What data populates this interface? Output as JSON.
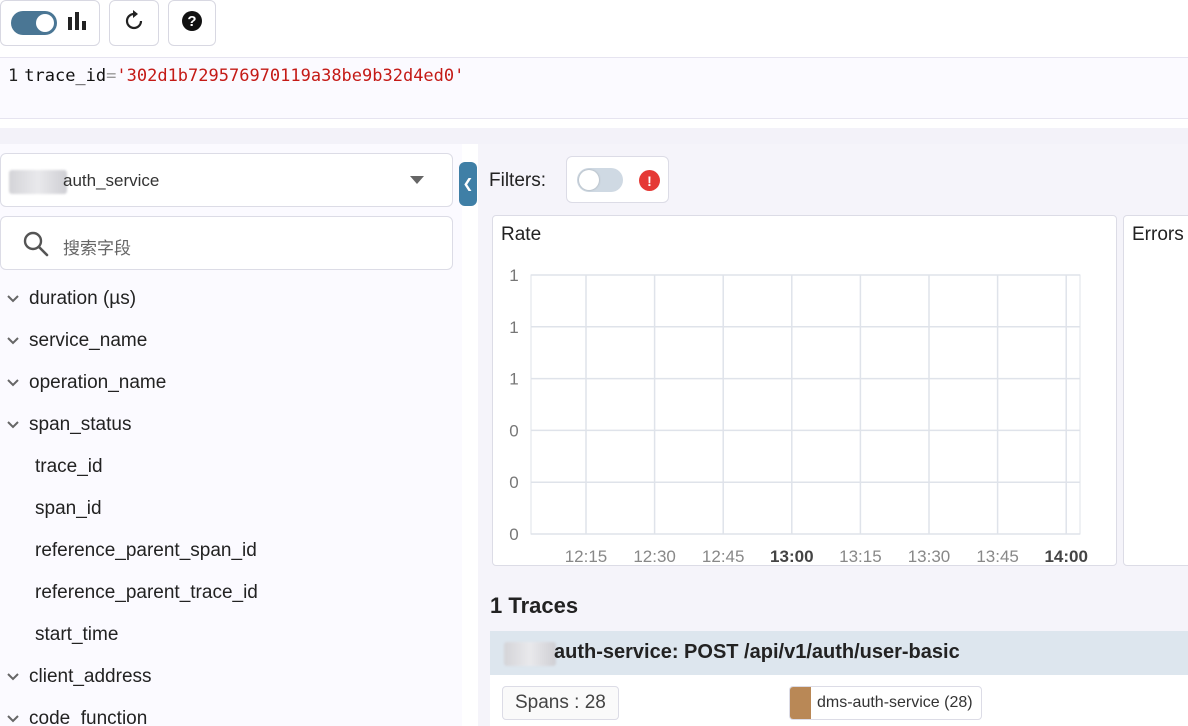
{
  "toolbar": {
    "toggle_state": "on",
    "chart_icon": "bar-chart-icon",
    "refresh_icon": "refresh-icon",
    "help_icon": "help-icon"
  },
  "editor": {
    "line_number": "1",
    "field": "trace_id",
    "operator": "=",
    "value": "'302d1b729576970119a38be9b32d4ed0'"
  },
  "sidebar": {
    "service_selected": "auth_service",
    "search_placeholder": "搜索字段",
    "fields": [
      {
        "label": "duration (µs)",
        "expandable": true
      },
      {
        "label": "service_name",
        "expandable": true
      },
      {
        "label": "operation_name",
        "expandable": true
      },
      {
        "label": "span_status",
        "expandable": true
      },
      {
        "label": "trace_id",
        "expandable": false
      },
      {
        "label": "span_id",
        "expandable": false
      },
      {
        "label": "reference_parent_span_id",
        "expandable": false
      },
      {
        "label": "reference_parent_trace_id",
        "expandable": false
      },
      {
        "label": "start_time",
        "expandable": false
      },
      {
        "label": "client_address",
        "expandable": true
      },
      {
        "label": "code_function",
        "expandable": true
      }
    ]
  },
  "filters": {
    "label": "Filters:",
    "toggle_state": "off"
  },
  "chart_data": {
    "type": "line",
    "title": "Rate",
    "x_ticks": [
      "12:15",
      "12:30",
      "12:45",
      "13:00",
      "13:15",
      "13:30",
      "13:45",
      "14:00"
    ],
    "x_ticks_bold": [
      "13:00",
      "14:00"
    ],
    "y_ticks": [
      "1",
      "1",
      "1",
      "0",
      "0",
      "0"
    ],
    "series": [],
    "grid": true
  },
  "errors_chart": {
    "title": "Errors"
  },
  "traces": {
    "title": "1 Traces",
    "items": [
      {
        "header": "auth-service:  POST /api/v1/auth/user-basic",
        "spans_badge": "Spans : 28",
        "service_badge": "dms-auth-service (28)",
        "service_color": "#b98856"
      }
    ]
  }
}
